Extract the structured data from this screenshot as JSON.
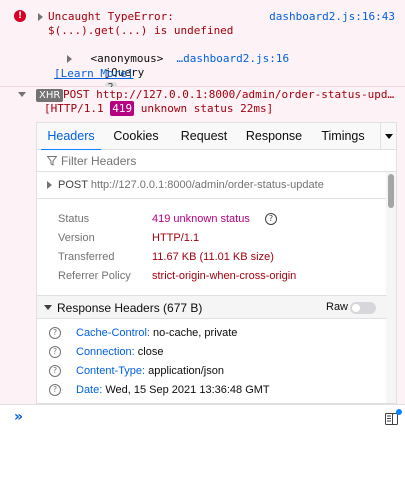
{
  "error": {
    "line1": "Uncaught TypeError:",
    "line2": "$(...).get(...) is undefined",
    "source": "dashboard2.js:16:43",
    "stack": [
      {
        "name": "<anonymous>",
        "location": "…dashboard2.js:16"
      },
      {
        "name": "jQuery",
        "count": "2"
      }
    ],
    "learn_more": "[Learn More]",
    "icon": "error-icon",
    "color": "#a4000f"
  },
  "xhr": {
    "tag": "XHR",
    "method": "POST",
    "url": "http://127.0.0.1:8000/admin/order-status-upd…",
    "protocol": "[HTTP/1.1",
    "status_code": "419",
    "status_rest": "unknown status 22ms]"
  },
  "tabs": [
    "Headers",
    "Cookies",
    "Request",
    "Response",
    "Timings"
  ],
  "active_tab": "Headers",
  "filter": {
    "placeholder": "Filter Headers"
  },
  "request": {
    "method": "POST",
    "url": "http://127.0.0.1:8000/admin/order-status-update"
  },
  "summary": [
    {
      "label": "Status",
      "value": "419 unknown status"
    },
    {
      "label": "Version",
      "value": "HTTP/1.1"
    },
    {
      "label": "Transferred",
      "value": "11.67 KB (11.01 KB size)"
    },
    {
      "label": "Referrer Policy",
      "value": "strict-origin-when-cross-origin"
    }
  ],
  "response_headers": {
    "title": "Response Headers (677 B)",
    "raw_label": "Raw",
    "raw_enabled": false,
    "items": [
      {
        "name": "Cache-Control:",
        "value": "no-cache, private"
      },
      {
        "name": "Connection:",
        "value": "close"
      },
      {
        "name": "Content-Type:",
        "value": "application/json"
      },
      {
        "name": "Date:",
        "value": "Wed, 15 Sep 2021 13:36:48 GMT"
      }
    ]
  },
  "console": {
    "prompt": "»"
  },
  "colors": {
    "error_bg": "#fdf2f5",
    "accent": "#0060df",
    "status_badge": "#b5007f"
  }
}
